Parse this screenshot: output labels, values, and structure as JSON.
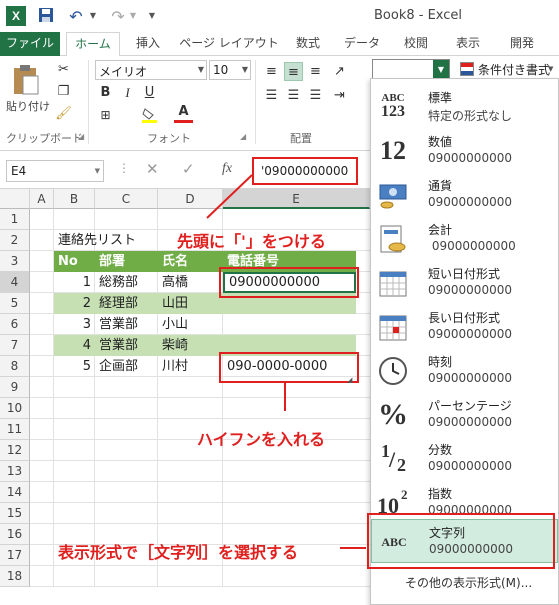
{
  "window": {
    "title": "Book8 - Excel"
  },
  "ribbon_tabs": [
    {
      "label": "ファイル"
    },
    {
      "label": "ホーム"
    },
    {
      "label": "挿入"
    },
    {
      "label": "ページ レイアウト"
    },
    {
      "label": "数式"
    },
    {
      "label": "データ"
    },
    {
      "label": "校閲"
    },
    {
      "label": "表示"
    },
    {
      "label": "開発"
    }
  ],
  "ribbon": {
    "paste": "貼り付け",
    "font_name": "メイリオ",
    "font_size": "10",
    "cond_format": "条件付き書式",
    "groups": {
      "clipboard": "クリップボード",
      "font": "フォント",
      "alignment": "配置"
    }
  },
  "formula_bar": {
    "name_box": "E4",
    "formula": "'09000000000",
    "fx": "fx"
  },
  "columns": [
    "A",
    "B",
    "C",
    "D",
    "E"
  ],
  "rows": [
    "1",
    "2",
    "3",
    "4",
    "5",
    "6",
    "7",
    "8",
    "9",
    "10",
    "11",
    "12",
    "13",
    "14",
    "15",
    "16",
    "17",
    "18"
  ],
  "sheet": {
    "title": "連絡先リスト",
    "headers": [
      "No",
      "部署",
      "氏名",
      "電話番号"
    ],
    "records": [
      {
        "no": "1",
        "dept": "総務部",
        "name": "高橋",
        "phone": "09000000000"
      },
      {
        "no": "2",
        "dept": "経理部",
        "name": "山田",
        "phone": ""
      },
      {
        "no": "3",
        "dept": "営業部",
        "name": "小山",
        "phone": ""
      },
      {
        "no": "4",
        "dept": "営業部",
        "name": "柴崎",
        "phone": ""
      },
      {
        "no": "5",
        "dept": "企画部",
        "name": "川村",
        "phone": "090-0000-0000"
      }
    ]
  },
  "callouts": {
    "c1": "先頭に「'」をつける",
    "c2": "ハイフンを入れる",
    "c3": "表示形式で［文字列］を選択する"
  },
  "number_formats": [
    {
      "name": "標準",
      "sample": "特定の形式なし",
      "icon": "general-icon"
    },
    {
      "name": "数値",
      "sample": "09000000000",
      "icon": "number-icon"
    },
    {
      "name": "通貨",
      "sample": "09000000000",
      "icon": "currency-icon"
    },
    {
      "name": "会計",
      "sample": " 09000000000",
      "icon": "accounting-icon"
    },
    {
      "name": "短い日付形式",
      "sample": "09000000000",
      "icon": "short-date-icon"
    },
    {
      "name": "長い日付形式",
      "sample": "09000000000",
      "icon": "long-date-icon"
    },
    {
      "name": "時刻",
      "sample": "09000000000",
      "icon": "clock-icon"
    },
    {
      "name": "パーセンテージ",
      "sample": "09000000000",
      "icon": "percent-icon"
    },
    {
      "name": "分数",
      "sample": "09000000000",
      "icon": "fraction-icon"
    },
    {
      "name": "指数",
      "sample": "09000000000",
      "icon": "scientific-icon"
    },
    {
      "name": "文字列",
      "sample": "09000000000",
      "icon": "text-icon"
    }
  ],
  "more_formats": "その他の表示形式(M)...",
  "icon_text": {
    "general": "ABC",
    "general_num": "123",
    "number": "12",
    "text": "ABC",
    "percent": "%",
    "scientific": "10",
    "scientific_exp": "2",
    "fraction_num": "1",
    "fraction_den": "2"
  },
  "colors": {
    "excel_green": "#217346",
    "table_header": "#70ad47",
    "table_band": "#c6e0b4",
    "highlight": "#e0201f",
    "selected_item": "#d3ece0"
  }
}
